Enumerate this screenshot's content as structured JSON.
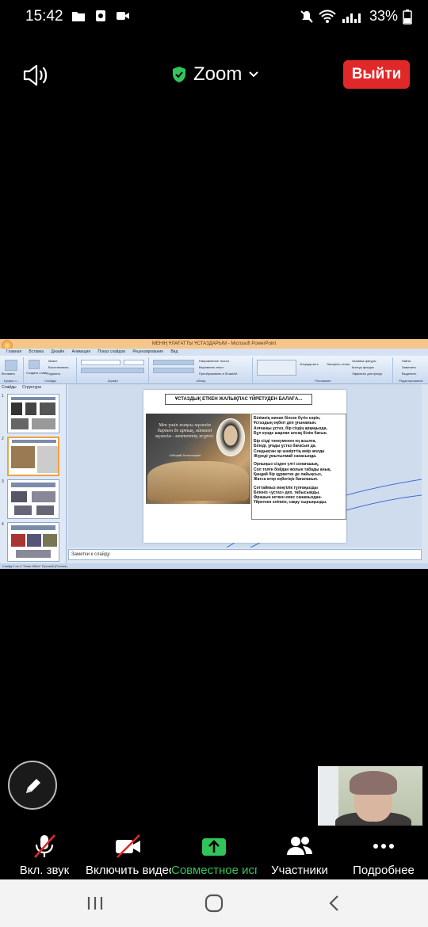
{
  "status_bar": {
    "time": "15:42",
    "battery": "33%",
    "icons": [
      "folder-icon",
      "screen-record-icon",
      "video-icon",
      "mute-icon",
      "wifi-icon",
      "signal-icon",
      "battery-icon"
    ]
  },
  "header": {
    "app_title": "Zoom",
    "leave_label": "Выйти",
    "accent_shield": "#31c45b",
    "leave_color": "#e02828"
  },
  "shared_screen": {
    "window_title": "МЕНІҢ ҰЛАҒАТТЫ ҰСТАЗДАРЫМ - Microsoft PowerPoint",
    "tabs": [
      "Главная",
      "Вставка",
      "Дизайн",
      "Анимация",
      "Показ слайдов",
      "Рецензирование",
      "Вид"
    ],
    "ribbon": {
      "groups": [
        "Буфер о...",
        "Слайды",
        "Шрифт",
        "Абзац",
        "Рисование",
        "Редактирование"
      ],
      "items": [
        "Вставить",
        "Создать слайд",
        "Макет",
        "Восстановить",
        "Удалить",
        "Направление текста",
        "Выровнять текст",
        "Преобразовать в SmartArt",
        "Упорядочить",
        "Экспресс-стили",
        "Заливка фигуры",
        "Контур фигуры",
        "Эффекты для фигур",
        "Найти",
        "Заменить",
        "Выделить"
      ]
    },
    "left_tabs": [
      "Слайды",
      "Структура"
    ],
    "slide_numbers": [
      "1",
      "2",
      "3",
      "4"
    ],
    "slide": {
      "title": "ҰСТАЗДЫҚ ЕТКЕН ЖАЛЫҚПАС  ҮЙРЕТУДЕН БАЛАҒА...",
      "quote": "Мен үшін жақсы мұғалім барінен де артық, өйткені мұғалім - мектептің жүрегі.",
      "quote_author": "Ыбырай Алтынсарин",
      "paragraphs": [
        "Білімнің жинап білсек бүгін нәрін,\nҰстаздың еңбегі деп ұғынамын.\nАлғашқы ұстаз, бір сіздің арқаңызда,\nБұл күнде шарлап алсақ білім бағын.",
        "Бір сізді тәнеуменен ең асылға,\nБіледі, ұғады ұстаз бағасын да.\nСондықтан әр шәкірттің өмір жолда\nЖүреді ұмытылмай санасында.",
        "Орныңыз сізден үлгі сонағашық,\nСол толғн бойдан жолын табады анық.\nҚандай бір құрметке де лайықсыз,\nЖатса өтер еңбегіңіз бағаланып.",
        "Сәттаймыз мәңгілік тұлғаңызды\nБіленіз «ұстаз» деп, табысымды.\nФрашын кеткен емес санамыздан-\nҮйреткен әліпиін, сақау сырыңызды."
      ]
    },
    "notes_placeholder": "Заметки к слайду",
    "status_text": "Слайд 2 из 4    \"Тема Office\"    Русский (Россия)"
  },
  "toolbar": {
    "items": [
      {
        "label": "Вкл. звук",
        "icon": "mic-muted-icon"
      },
      {
        "label": "Включить видео",
        "icon": "video-off-icon"
      },
      {
        "label": "Совместное использование",
        "icon": "share-screen-icon"
      },
      {
        "label": "Участники",
        "icon": "participants-icon"
      },
      {
        "label": "Подробнее",
        "icon": "more-icon"
      }
    ],
    "share_color": "#31c45b",
    "muted_color": "#e02828"
  },
  "navbar": {
    "icons": [
      "recent-apps-icon",
      "home-icon",
      "back-icon"
    ]
  }
}
